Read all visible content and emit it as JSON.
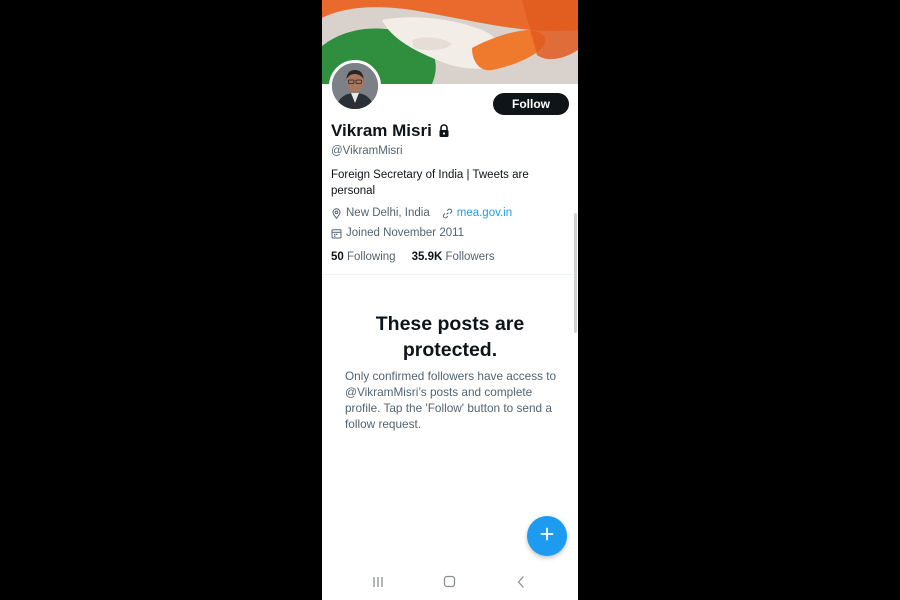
{
  "profile": {
    "display_name": "Vikram Misri",
    "handle": "@VikramMisri",
    "bio": "Foreign Secretary of India | Tweets are personal",
    "location": "New Delhi, India",
    "website": "mea.gov.in",
    "joined": "Joined November 2011",
    "following_count": "50",
    "following_label": "Following",
    "followers_count": "35.9K",
    "followers_label": "Followers",
    "follow_button_label": "Follow",
    "protected_account": true
  },
  "protected_notice": {
    "title": "These posts are protected.",
    "description": "Only confirmed followers have access to @VikramMisri’s posts and complete profile. Tap the 'Follow' button to send a follow request."
  },
  "icons": {
    "lock": "lock-icon",
    "location": "location-pin-icon",
    "link": "link-icon",
    "calendar": "calendar-icon",
    "compose": "plus-icon",
    "nav_recents": "recents-icon",
    "nav_home": "home-icon",
    "nav_back": "back-icon"
  },
  "colors": {
    "accent": "#1d9bf0",
    "follow_button_bg": "#0f1419",
    "secondary_text": "#536471",
    "background": "#ffffff"
  }
}
